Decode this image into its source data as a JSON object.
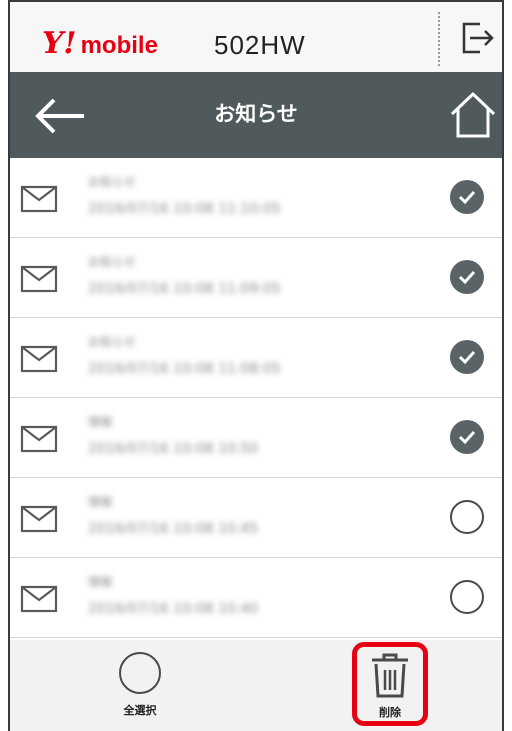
{
  "header": {
    "logo_mark": "Y!",
    "logo_word": "mobile",
    "model": "502HW"
  },
  "nav": {
    "title": "お知らせ"
  },
  "notices": [
    {
      "title": "お知らせ",
      "subtitle": "2016/07/16 10:08 11:10:05",
      "checked": true
    },
    {
      "title": "お知らせ",
      "subtitle": "2016/07/16 10:08 11:09:05",
      "checked": true
    },
    {
      "title": "お知らせ",
      "subtitle": "2016/07/16 10:08 11:08:05",
      "checked": true
    },
    {
      "title": "情報",
      "subtitle": "2016/07/16 10:08 10:50",
      "checked": true
    },
    {
      "title": "情報",
      "subtitle": "2016/07/16 10:08 10:45",
      "checked": false
    },
    {
      "title": "情報",
      "subtitle": "2016/07/16 10:08 10:40",
      "checked": false
    }
  ],
  "toolbar": {
    "select_all_label": "全選択",
    "delete_label": "削除"
  },
  "colors": {
    "brand_red": "#e60012",
    "navbar": "#505a5c",
    "checked": "#5a6466"
  }
}
